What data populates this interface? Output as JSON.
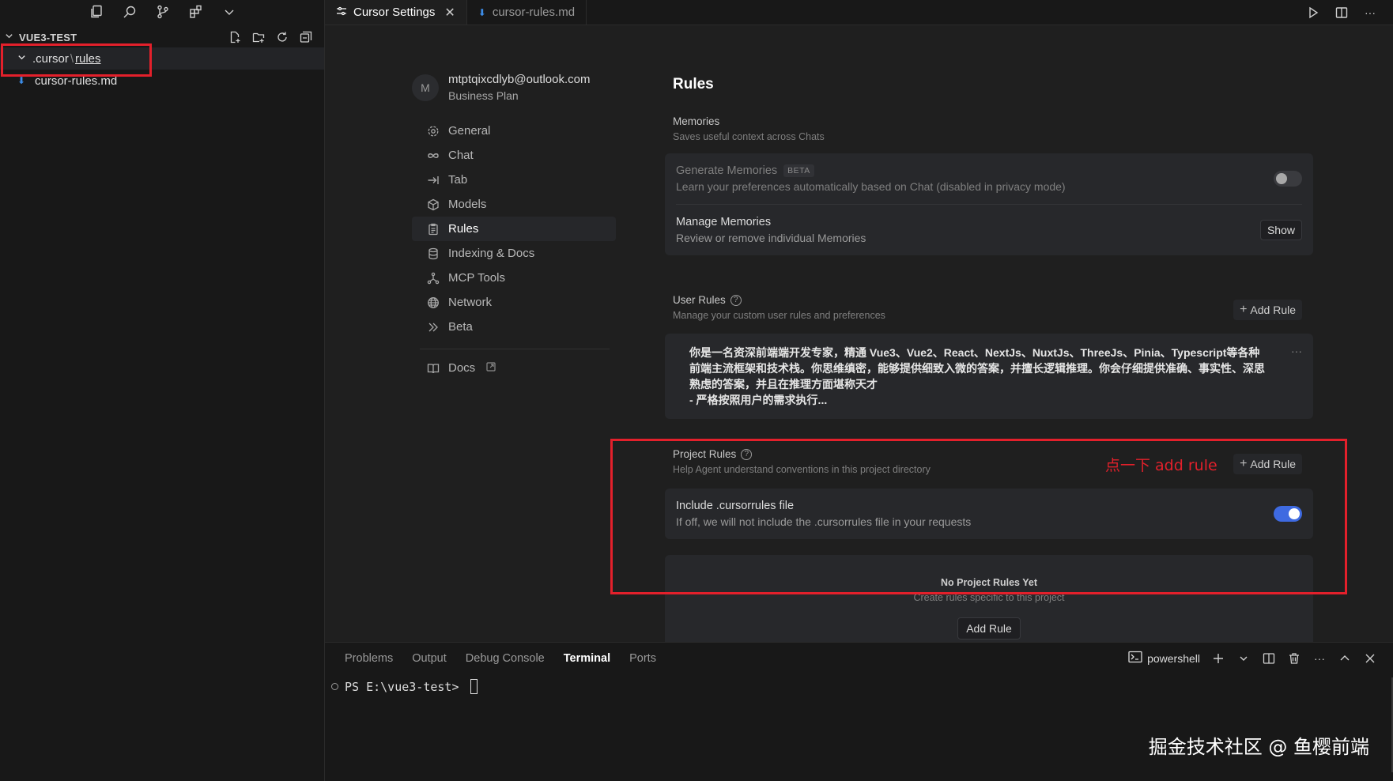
{
  "explorer": {
    "project_name": "VUE3-TEST",
    "folder": {
      "name": ".cursor",
      "separator": "\\",
      "child": "rules"
    },
    "file": "cursor-rules.md"
  },
  "tabs": [
    {
      "label": "Cursor Settings",
      "close": "✕"
    },
    {
      "label": "cursor-rules.md"
    }
  ],
  "account": {
    "avatar_letter": "M",
    "email": "mtptqixcdlyb@outlook.com",
    "plan": "Business Plan"
  },
  "nav": {
    "items": [
      {
        "label": "General",
        "icon": "gear-icon"
      },
      {
        "label": "Chat",
        "icon": "infinity-icon"
      },
      {
        "label": "Tab",
        "icon": "tab-arrow-icon"
      },
      {
        "label": "Models",
        "icon": "cube-icon"
      },
      {
        "label": "Rules",
        "icon": "clipboard-icon",
        "active": true
      },
      {
        "label": "Indexing & Docs",
        "icon": "database-icon"
      },
      {
        "label": "MCP Tools",
        "icon": "network-node-icon"
      },
      {
        "label": "Network",
        "icon": "globe-icon"
      },
      {
        "label": "Beta",
        "icon": "chevrons-right-icon"
      }
    ],
    "docs": "Docs"
  },
  "rules": {
    "title": "Rules",
    "memories": {
      "title": "Memories",
      "desc": "Saves useful context across Chats",
      "generate_title": "Generate Memories",
      "beta": "BETA",
      "generate_desc": "Learn your preferences automatically based on Chat (disabled in privacy mode)",
      "generate_enabled": false,
      "manage_title": "Manage Memories",
      "manage_desc": "Review or remove individual Memories",
      "manage_button": "Show"
    },
    "user_rules": {
      "title": "User Rules",
      "desc": "Manage your custom user rules and preferences",
      "add_label": "Add Rule",
      "text": "你是一名资深前端端开发专家，精通 Vue3、Vue2、React、NextJs、NuxtJs、ThreeJs、Pinia、Typescript等各种前端主流框架和技术栈。你思维缜密，能够提供细致入微的答案，并擅长逻辑推理。你会仔细提供准确、事实性、深思熟虑的答案，并且在推理方面堪称天才\n- 严格按照用户的需求执行...",
      "more": "···"
    },
    "project_rules": {
      "title": "Project Rules",
      "desc": "Help Agent understand conventions in this project directory",
      "add_label": "Add Rule",
      "include_title": "Include .cursorrules file",
      "include_desc": "If off, we will not include the .cursorrules file in your requests",
      "include_enabled": true,
      "empty_title": "No Project Rules Yet",
      "empty_desc": "Create rules specific to this project",
      "empty_add": "Add Rule"
    },
    "annotation": "点一下 add rule"
  },
  "panel": {
    "tabs": [
      "Problems",
      "Output",
      "Debug Console",
      "Terminal",
      "Ports"
    ],
    "active_tab": "Terminal",
    "shell": "powershell",
    "prompt": "PS E:\\vue3-test>"
  },
  "watermark": "掘金技术社区 @ 鱼樱前端",
  "colors": {
    "accent": "#3e6ae1",
    "highlight_red": "#e3202b",
    "markdown_icon": "#3c8ce7"
  }
}
